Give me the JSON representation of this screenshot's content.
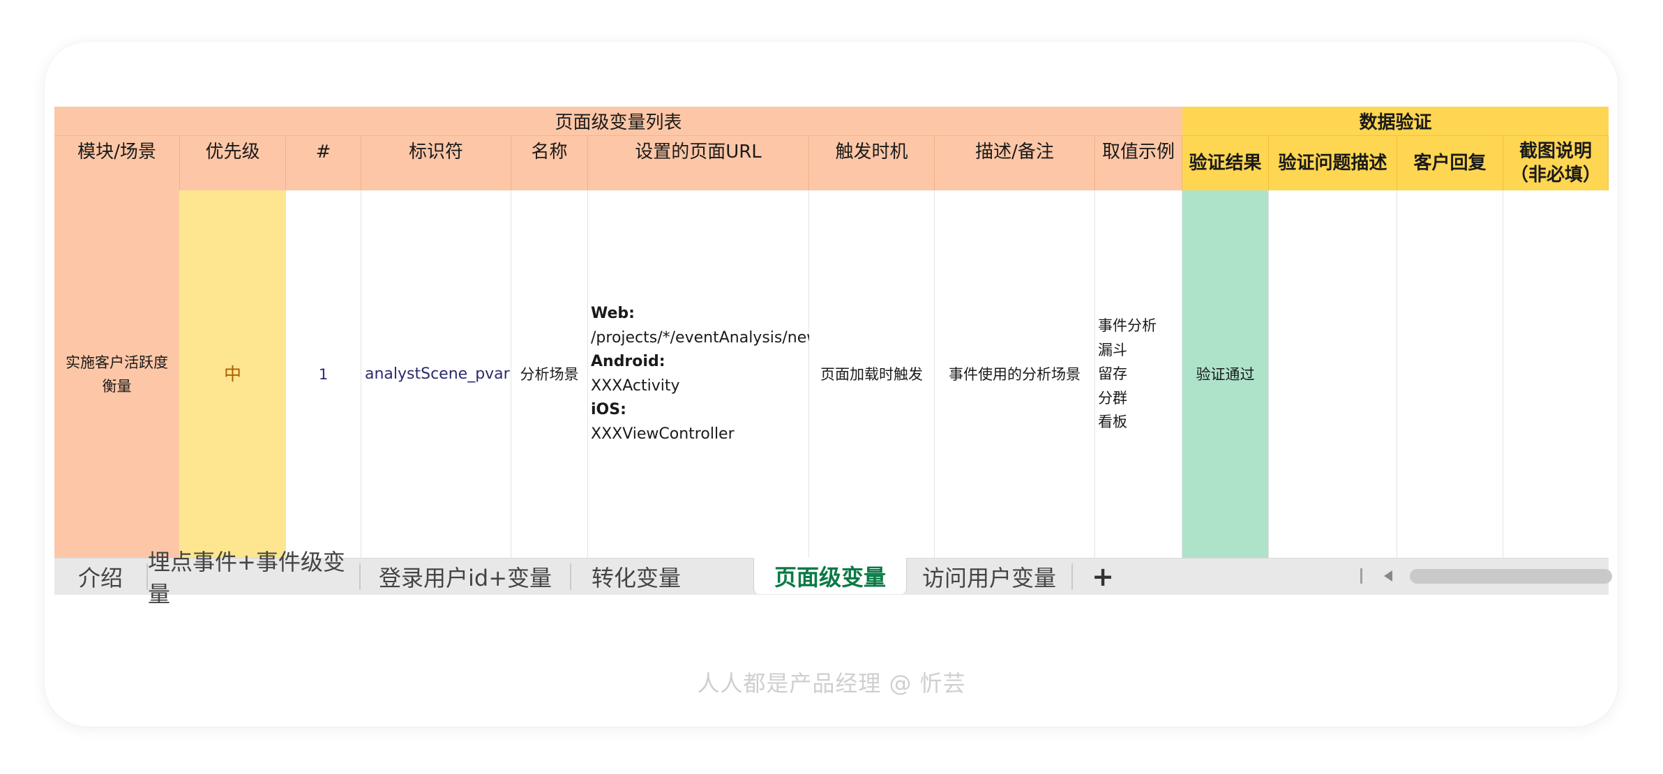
{
  "table": {
    "group_headers": {
      "left": "页面级变量列表",
      "right": "数据验证"
    },
    "columns": [
      "模块/场景",
      "优先级",
      "#",
      "标识符",
      "名称",
      "设置的页面URL",
      "触发时机",
      "描述/备注",
      "取值示例",
      "验证结果",
      "验证问题描述",
      "客户回复",
      "截图说明（非必填）"
    ],
    "row": {
      "module": "实施客户活跃度衡量",
      "priority": "中",
      "index": "1",
      "identifier": "analystScene_pvar",
      "name": "分析场景",
      "url": {
        "web_label": "Web:",
        "web_value": "/projects/*/eventAnalysis/new",
        "android_label": "Android:",
        "android_value": "XXXActivity",
        "ios_label": "iOS:",
        "ios_value": "XXXViewController"
      },
      "trigger": "页面加载时触发",
      "description": "事件使用的分析场景",
      "examples": [
        "事件分析",
        "漏斗",
        "留存",
        "分群",
        "看板"
      ],
      "verify_result": "验证通过",
      "issue": "",
      "reply": "",
      "screenshot_note": ""
    }
  },
  "sheet_tabs": [
    {
      "label": "介绍",
      "active": false
    },
    {
      "label": "埋点事件+事件级变量",
      "active": false
    },
    {
      "label": "登录用户id+变量",
      "active": false
    },
    {
      "label": "转化变量",
      "active": false
    },
    {
      "label": "页面级变量",
      "active": true
    },
    {
      "label": "访问用户变量",
      "active": false
    }
  ],
  "add_sheet_label": "+",
  "watermark": "人人都是产品经理 @ 忻芸",
  "colors": {
    "header_pink": "#fdc7a7",
    "header_gold": "#fed651",
    "priority_yellow": "#fde68f",
    "verify_green": "#aee3ca",
    "active_tab_green": "#0a7a45",
    "priority_text": "#b35c00",
    "link_text": "#2a2a6e"
  },
  "icons": {
    "add_sheet": "plus-icon",
    "scroll_first": "scroll-stop-icon",
    "scroll_left": "triangle-left-icon"
  }
}
